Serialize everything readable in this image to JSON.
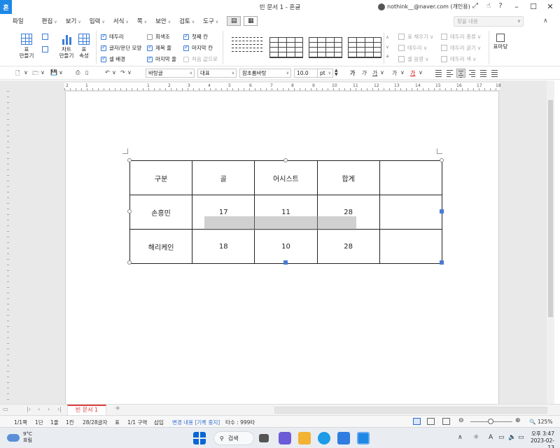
{
  "window": {
    "title": "빈 문서 1 - 혼글",
    "app_logo": "혼",
    "user": "nothink__@naver.com (개인용)",
    "icons": [
      "user-avatar-icon",
      "restore-icon",
      "hand-icon",
      "help-icon",
      "minimize-icon",
      "maximize-icon",
      "close-icon"
    ]
  },
  "menubar": {
    "items": [
      "파일",
      "편집",
      "보기",
      "입력",
      "서식",
      "쪽",
      "보안",
      "검토",
      "도구"
    ],
    "search_placeholder": "찾을 내용"
  },
  "ribbon": {
    "table_create": "표\n만들기",
    "chart_create": "차트\n만들기",
    "table_props": "표\n속성",
    "checkboxes": [
      {
        "label": "테두리",
        "checked": true
      },
      {
        "label": "글자/문단 모양",
        "checked": true
      },
      {
        "label": "셀 배경",
        "checked": true
      },
      {
        "label": "회색조",
        "checked": false
      },
      {
        "label": "제목 줄",
        "checked": true
      },
      {
        "label": "마지막 줄",
        "checked": true
      },
      {
        "label": "첫째 칸",
        "checked": true
      },
      {
        "label": "마지막 칸",
        "checked": true
      },
      {
        "label": "처음 값으로",
        "checked": false,
        "disabled": true
      }
    ],
    "disabled_tools": [
      "표 채우기",
      "테두리",
      "셀 음영",
      "테두리 종류",
      "테두리 굵기",
      "테두리 색"
    ],
    "bookmark": "표마당"
  },
  "toolbar2": {
    "style": "바탕글",
    "style_type": "대표",
    "font": "함초롬바탕",
    "size": "10.0",
    "unit": "pt"
  },
  "ruler": {
    "h_labels": [
      "2",
      "1",
      "1",
      "2",
      "3",
      "4",
      "5",
      "6",
      "7",
      "8",
      "9",
      "10",
      "11",
      "12",
      "13",
      "14",
      "15",
      "16",
      "17",
      "18"
    ]
  },
  "table": {
    "rows": [
      [
        "구분",
        "골",
        "어시스트",
        "합계",
        ""
      ],
      [
        "손흥민",
        "17",
        "11",
        "28",
        ""
      ],
      [
        "해리케인",
        "18",
        "10",
        "28",
        ""
      ]
    ]
  },
  "tabs": {
    "doc_tab": "빈 문서 1",
    "add": "+"
  },
  "statusbar": {
    "page": "1/1쪽",
    "section": "1단",
    "line": "1줄",
    "col": "1칸",
    "chars": "28/28글자",
    "kind": "표",
    "zone": "1/1 구역",
    "mode": "삽입",
    "track": "변경 내용 [기록 중지]",
    "typing": "타수 : 999타",
    "zoom": "125%"
  },
  "taskbar": {
    "temp": "9°C",
    "weather": "흐림",
    "search": "검색",
    "time": "오후 3:47",
    "date": "2023-02-13",
    "lang": "A"
  }
}
